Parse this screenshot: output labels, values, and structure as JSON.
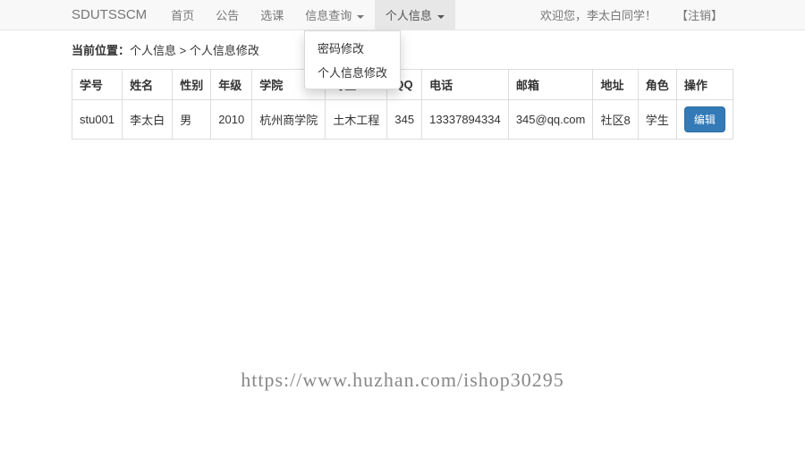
{
  "navbar": {
    "brand": "SDUTSSCM",
    "items": [
      {
        "label": "首页"
      },
      {
        "label": "公告"
      },
      {
        "label": "选课"
      },
      {
        "label": "信息查询",
        "caret": true
      },
      {
        "label": "个人信息",
        "caret": true,
        "open": true
      }
    ],
    "dropdown": [
      "密码修改",
      "个人信息修改"
    ],
    "welcome": "欢迎您，李太白同学！",
    "logout": "【注销】"
  },
  "breadcrumb": {
    "label": "当前位置：",
    "path": "个人信息 > 个人信息修改"
  },
  "table": {
    "headers": [
      "学号",
      "姓名",
      "性别",
      "年级",
      "学院",
      "专业",
      "QQ",
      "电话",
      "邮箱",
      "地址",
      "角色",
      "操作"
    ],
    "row": {
      "student_id": "stu001",
      "name": "李太白",
      "gender": "男",
      "grade": "2010",
      "college": "杭州商学院",
      "major": "土木工程",
      "qq": "345",
      "phone": "13337894334",
      "email": "345@qq.com",
      "address": "社区8",
      "role": "学生",
      "action": "编辑"
    }
  },
  "watermark": "https://www.huzhan.com/ishop30295"
}
